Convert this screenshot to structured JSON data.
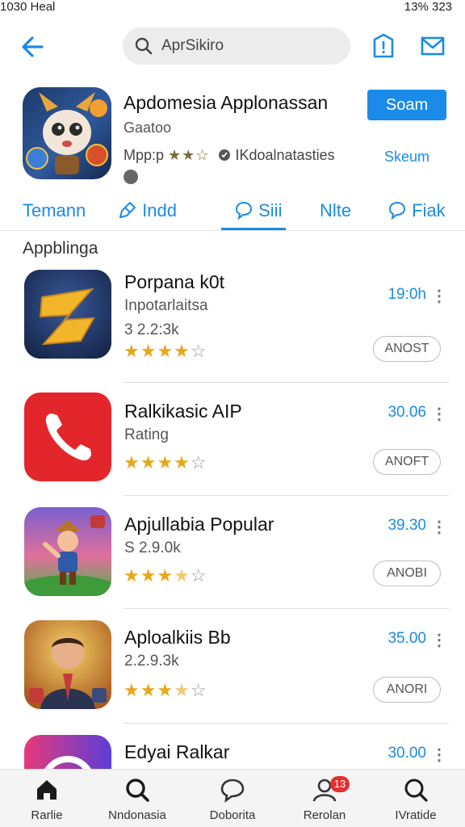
{
  "status_bar": {
    "left_text": "1030 Heal",
    "right_text": "13% 323"
  },
  "search": {
    "placeholder": "AprSikiro"
  },
  "featured": {
    "title": "Apdomesia Applonassan",
    "subtitle": "Gaatoo",
    "meta_prefix": "Mpp:p",
    "meta_stars": "★★☆",
    "meta_suffix": "IKdoalnatasties",
    "primary_button": "Soam",
    "link_text": "Skeum"
  },
  "tabs": [
    {
      "label": "Temann",
      "icon": "none"
    },
    {
      "label": "Indd",
      "icon": "tag-icon"
    },
    {
      "label": "Siii",
      "icon": "chat-icon",
      "active": true
    },
    {
      "label": "Nlte",
      "icon": "none"
    },
    {
      "label": "Fiak",
      "icon": "chat-icon"
    }
  ],
  "section_title": "Appblinga",
  "apps": [
    {
      "name": "Porpana k0t",
      "line2": "Inpotarlaitsa",
      "line3": "3 2.2:3k",
      "rating": 4,
      "price": "19:0h",
      "button": "ANOST",
      "icon_kind": "z-logo-icon",
      "icon_colors": [
        "#1e3560",
        "#f2b62a"
      ]
    },
    {
      "name": "Ralkikasic AIP",
      "line2": "Rating",
      "line3": "",
      "rating": 4,
      "price": "30.06",
      "button": "ANOFT",
      "icon_kind": "phone-icon",
      "icon_colors": [
        "#e3262b",
        "#ffffff"
      ]
    },
    {
      "name": "Apjullabia Popular",
      "line2": "S 2.9.0k",
      "line3": "",
      "rating": 3.5,
      "price": "39.30",
      "button": "ANOBI",
      "icon_kind": "cartoon-character-icon",
      "icon_colors": [
        "#7a5fd0",
        "#f0a46a"
      ]
    },
    {
      "name": "Aploalkiis Bb",
      "line2": "2.2.9.3k",
      "line3": "",
      "rating": 3.5,
      "price": "35.00",
      "button": "ANORI",
      "icon_kind": "businessman-icon",
      "icon_colors": [
        "#a9581c",
        "#f4d26a"
      ]
    },
    {
      "name": "Edyai Ralkar",
      "line2": "",
      "line3": "",
      "rating": 0,
      "price": "30.00",
      "button": "",
      "icon_kind": "gradient-ring-icon",
      "icon_colors": [
        "#e6397a",
        "#5a3fd8"
      ]
    }
  ],
  "bottom_nav": [
    {
      "label": "Rarlie",
      "icon": "home-icon"
    },
    {
      "label": "Nndonasia",
      "icon": "search-icon"
    },
    {
      "label": "Doborita",
      "icon": "chat-icon"
    },
    {
      "label": "Rerolan",
      "icon": "person-icon",
      "badge": "13"
    },
    {
      "label": "IVratide",
      "icon": "search-icon"
    }
  ]
}
